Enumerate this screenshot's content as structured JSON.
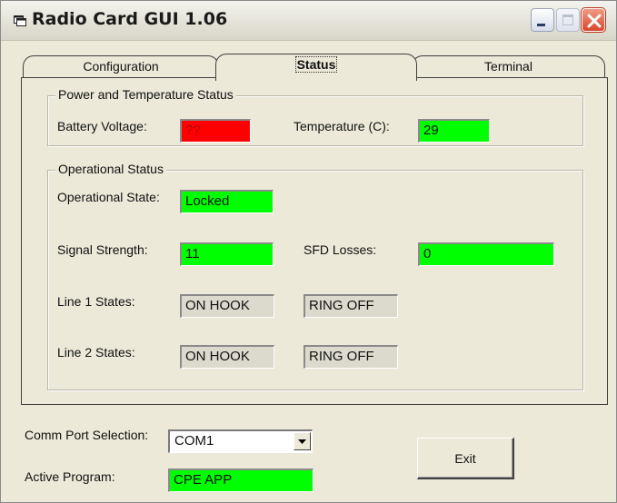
{
  "window": {
    "title": "Radio Card GUI 1.06",
    "icon": "app-window-icon"
  },
  "tabs": [
    {
      "label": "Configuration",
      "active": false
    },
    {
      "label": "Status",
      "active": true
    },
    {
      "label": "Terminal",
      "active": false
    }
  ],
  "power_group": {
    "title": "Power and Temperature Status",
    "battery_label": "Battery Voltage:",
    "battery_value": "??",
    "battery_color": "#ff0000",
    "temperature_label": "Temperature (C):",
    "temperature_value": "29",
    "temperature_color": "#00ff00"
  },
  "operational_group": {
    "title": "Operational Status",
    "state_label": "Operational State:",
    "state_value": "Locked",
    "signal_label": "Signal Strength:",
    "signal_value": "11",
    "sfd_label": "SFD Losses:",
    "sfd_value": "0",
    "line1_label": "Line 1 States:",
    "line1_hook": "ON HOOK",
    "line1_ring": "RING OFF",
    "line2_label": "Line 2 States:",
    "line2_hook": "ON HOOK",
    "line2_ring": "RING OFF"
  },
  "bottom": {
    "comm_port_label": "Comm Port Selection:",
    "comm_port_value": "COM1",
    "active_program_label": "Active Program:",
    "active_program_value": "CPE APP",
    "exit_label": "Exit"
  },
  "colors": {
    "ok": "#00ff00",
    "error": "#ff0000",
    "inactive": "#dcd9cd",
    "window_bg": "#ece9d8"
  }
}
